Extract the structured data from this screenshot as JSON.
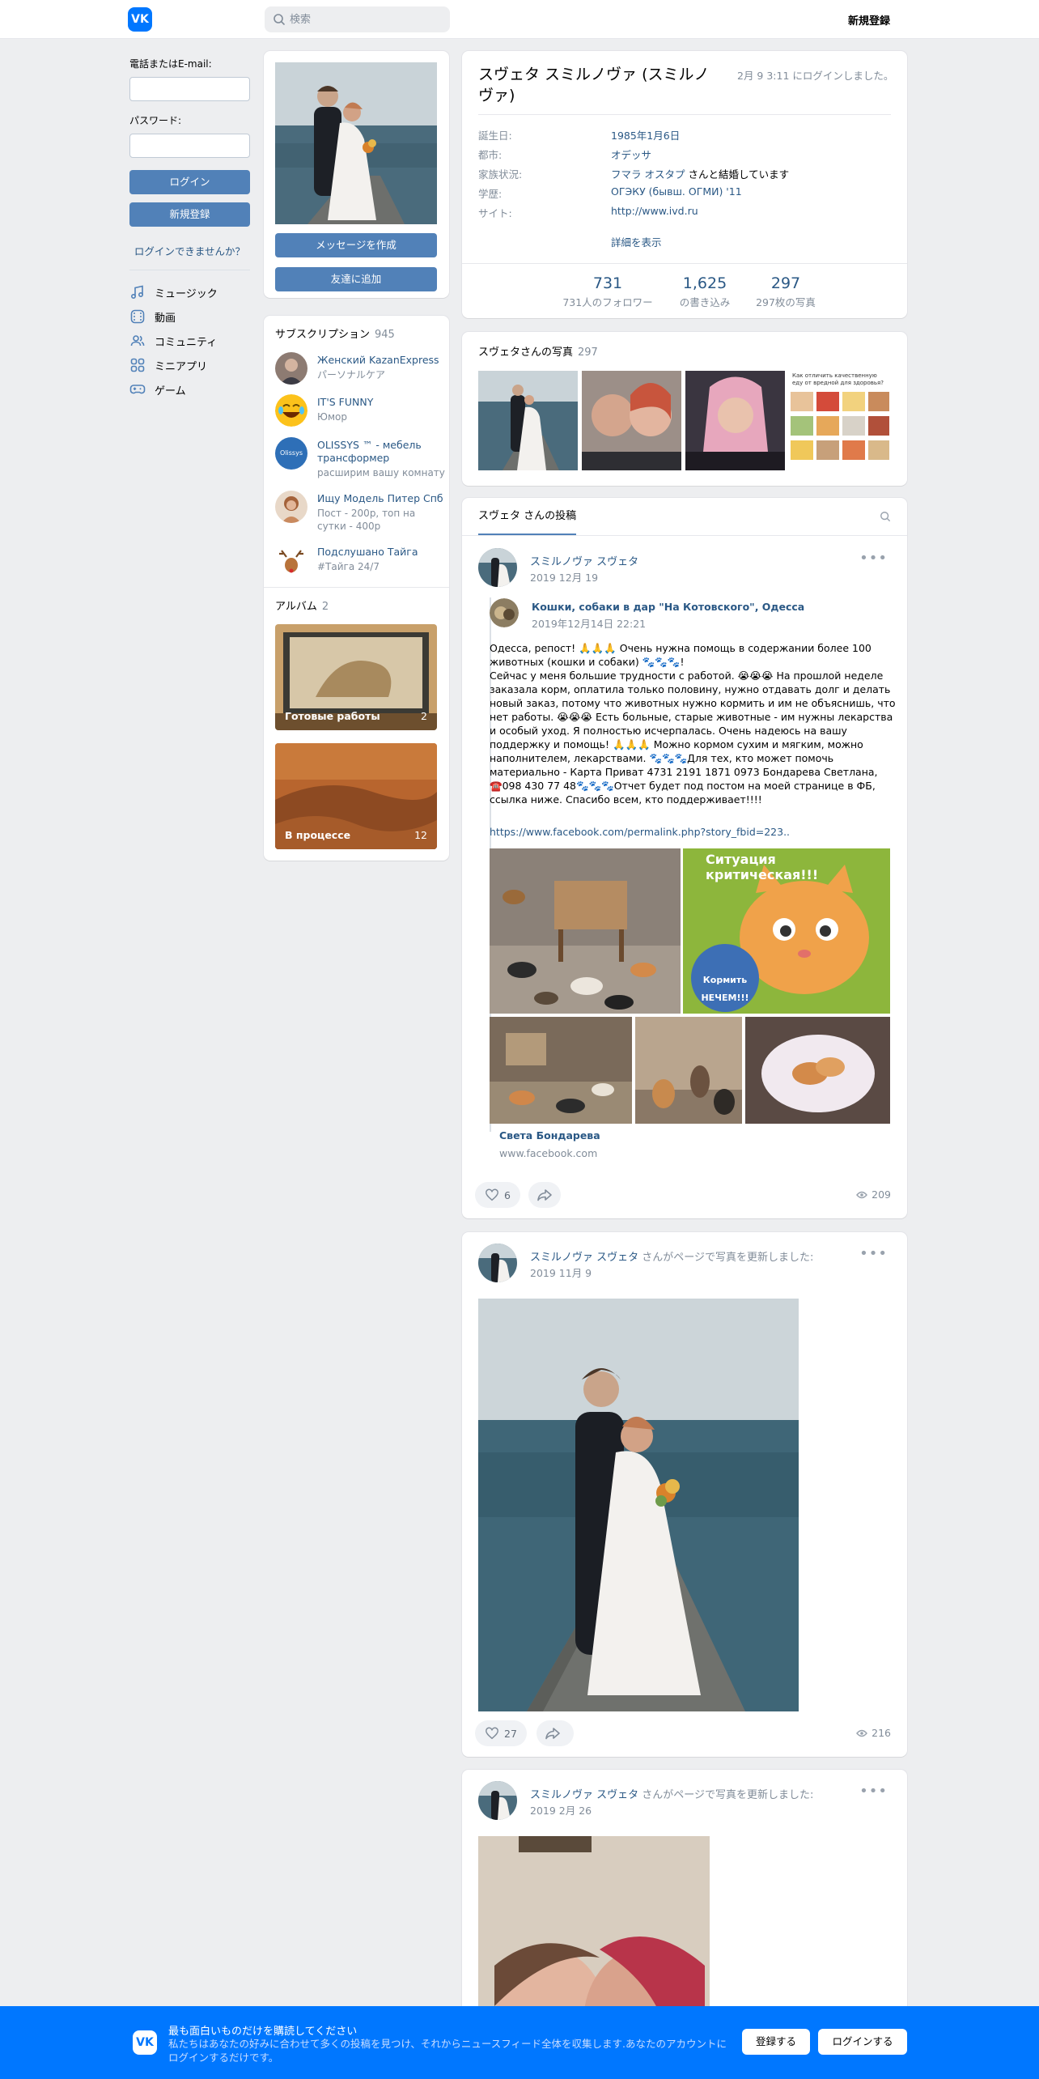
{
  "header": {
    "search_placeholder": "検索",
    "signup_label": "新規登録",
    "logo": "VK"
  },
  "login": {
    "email_label": "電話またはE-mail:",
    "password_label": "パスワード:",
    "login_button": "ログイン",
    "signup_button": "新規登録",
    "forgot_link": "ログインできませんか？"
  },
  "nav": [
    {
      "label": "ミュージック",
      "icon": "music-icon"
    },
    {
      "label": "動画",
      "icon": "video-icon"
    },
    {
      "label": "コミュニティ",
      "icon": "community-icon"
    },
    {
      "label": "ミニアプリ",
      "icon": "apps-icon"
    },
    {
      "label": "ゲーム",
      "icon": "games-icon"
    }
  ],
  "profile_actions": {
    "message_button": "メッセージを作成",
    "add_friend_button": "友達に追加"
  },
  "subscriptions": {
    "title": "サブスクリプション",
    "count": "945",
    "items": [
      {
        "name": "Женский KazanExpress",
        "desc": "パーソナルケア"
      },
      {
        "name": "IT'S FUNNY",
        "desc": "Юмор"
      },
      {
        "name": "OLISSYS ™ - мебель трансформер",
        "desc": "расширим вашу комнату"
      },
      {
        "name": "Ищу Модель Питер Спб",
        "desc": "Пост - 200р, топ на сутки - 400р"
      },
      {
        "name": "Подслушано Тайга",
        "desc": "#Тайга 24/7"
      }
    ],
    "olissys_logo": "Olissys"
  },
  "albums": {
    "title": "アルバム",
    "count": "2",
    "items": [
      {
        "name": "Готовые работы",
        "count": "2"
      },
      {
        "name": "В процессе",
        "count": "12"
      }
    ]
  },
  "profile": {
    "name": "スヴェタ スミルノヴァ (スミルノヴァ)",
    "last_seen": "2月 9 3:11 にログインしました。",
    "info": [
      {
        "key": "誕生日:",
        "value": "1985年1月6日",
        "link": true
      },
      {
        "key": "都市:",
        "value": "オデッサ",
        "link": true
      },
      {
        "key": "家族状況:",
        "value_link": "フマラ オスタプ",
        "value_tail": " さんと結婚しています"
      },
      {
        "key": "学歴:",
        "value": "ОГЭКУ (бывш. ОГМИ) '11",
        "link": true
      },
      {
        "key": "サイト:",
        "value": "http://www.ivd.ru",
        "link": true
      }
    ],
    "more_link": "詳細を表示",
    "counters": [
      {
        "num": "731",
        "label": "731人のフォロワー"
      },
      {
        "num": "1,625",
        "label": "の書き込み"
      },
      {
        "num": "297",
        "label": "297枚の写真"
      }
    ]
  },
  "photos": {
    "title": "スヴェタさんの写真",
    "count": "297",
    "thumb4_caption": "Как отличить качественную еду от вредной для здоровья?"
  },
  "wall": {
    "tab_label": "スヴェタ さんの投稿"
  },
  "posts": [
    {
      "author": "スミルノヴァ スヴェタ",
      "date": "2019 12月 19",
      "repost": {
        "group": "Кошки, собаки в дар \"На Котовского\", Одесса",
        "date": "2019年12月14日 22:21",
        "text": "Одесса, репост! 🙏🙏🙏 Очень нужна помощь в содержании более 100 животных (кошки и собаки) 🐾🐾🐾!\nСейчас у меня большие трудности с работой. 😭😭😭 На прошлой неделе заказала корм, оплатила только половину, нужно отдавать долг и делать новый заказ, потому что животных нужно кормить и им не объяснишь, что нет работы. 😭😭😭 Есть больные, старые животные - им нужны лекарства и особый уход. Я полностью исчерпалась. Очень надеюсь на вашу поддержку и помощь! 🙏🙏🙏 Можно кормом сухим и мягким, можно наполнителем, лекарствами. 🐾🐾🐾Для тех, кто может помочь материально - Карта Приват 4731 2191 1871 0973 Бондарева Светлана, ☎️098 430 77 48🐾🐾🐾Отчет будет под постом на моей странице в ФБ, ссылка ниже. Спасибо всем, кто поддерживает!!!!",
        "link": "https://www.facebook.com/permalink.php?story_fbid=223..",
        "overlay_title": "Ситуация критическая!!!",
        "overlay_badge": "Кормить НЕЧЕМ!!!",
        "link_author": "Света Бондарева",
        "link_domain": "www.facebook.com"
      },
      "likes": "6",
      "views": "209"
    },
    {
      "author": "スミルノヴァ スヴェタ",
      "extra": " さんがページで写真を更新しました:",
      "date": "2019 11月 9",
      "likes": "27",
      "views": "216"
    },
    {
      "author": "スミルノヴァ スヴェタ",
      "extra": " さんがページで写真を更新しました:",
      "date": "2019 2月 26"
    }
  ],
  "banner": {
    "title": "最も面白いものだけを購読してください",
    "text": "私たちはあなたの好みに合わせて多くの投稿を見つけ、それからニュースフィード全体を収集します.あなたのアカウントにログインするだけです。",
    "signup_button": "登録する",
    "login_button": "ログインする",
    "logo": "VK"
  },
  "colors": {
    "accent": "#0077ff",
    "button": "#5181b8",
    "link": "#2a5885",
    "background": "#edeef0"
  }
}
